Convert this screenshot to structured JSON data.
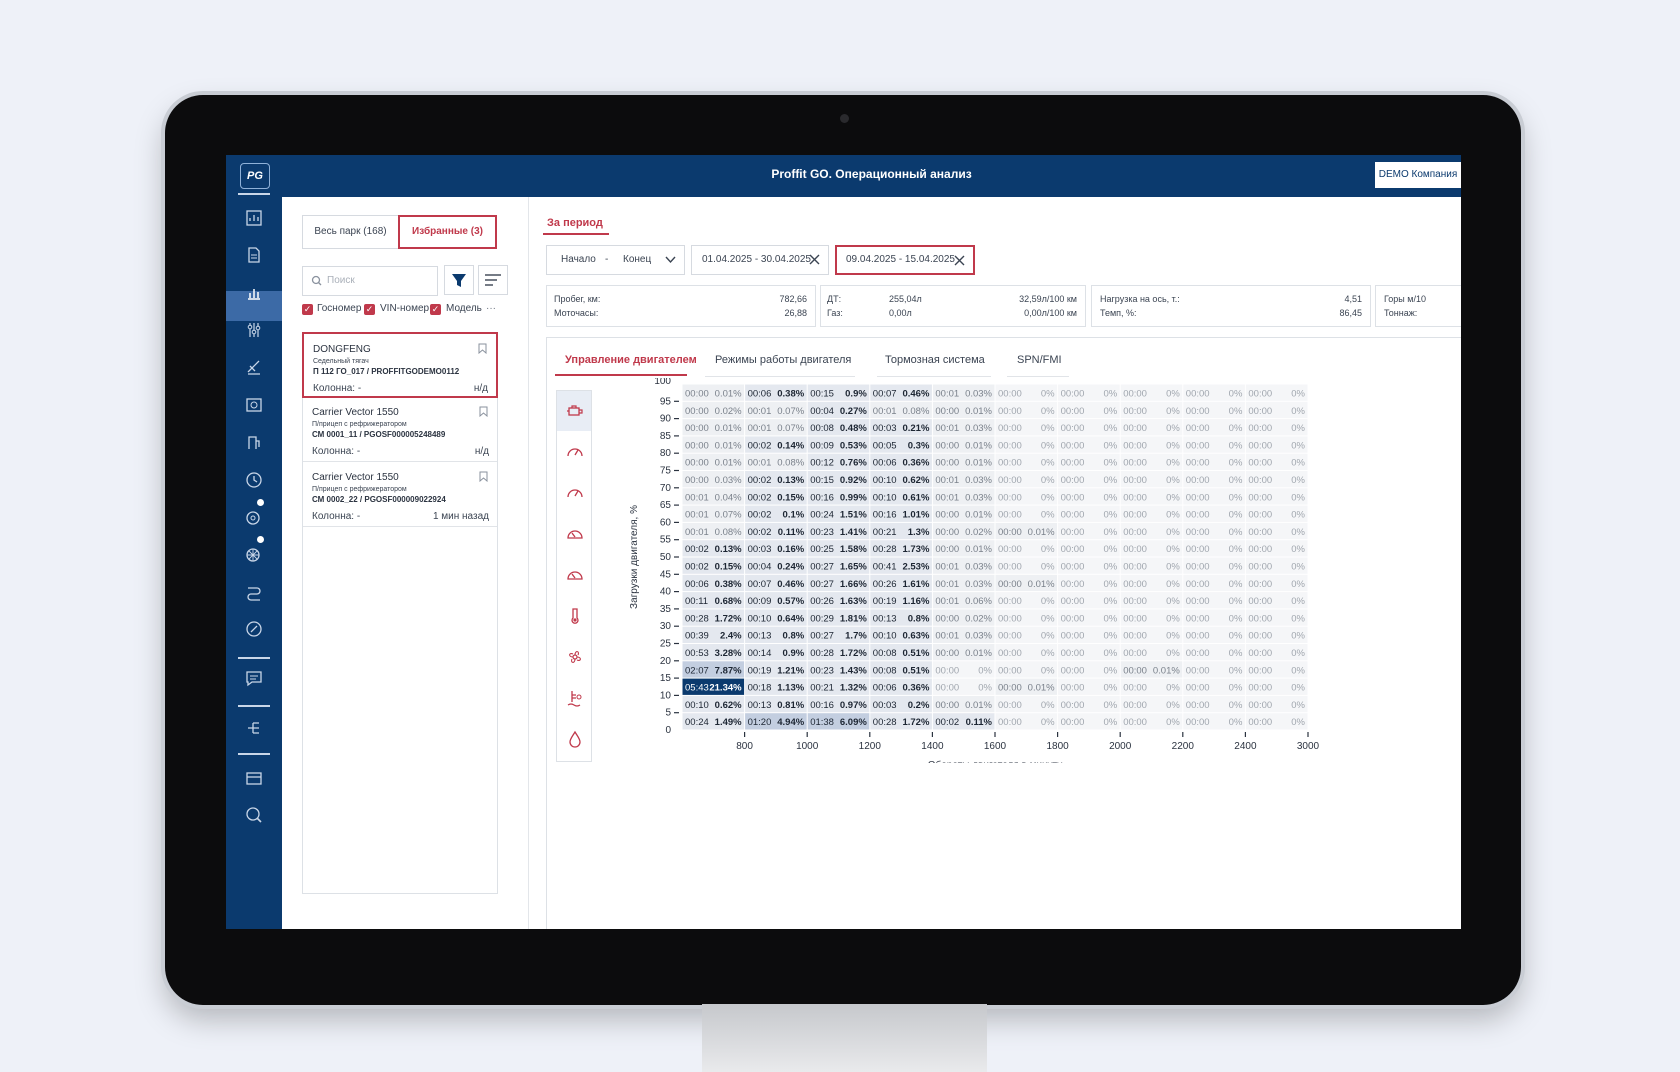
{
  "header": {
    "title": "Proffit GO. Операционный анализ",
    "company": "DEMO Компания"
  },
  "logo": "PG",
  "fleet_tabs": [
    {
      "label": "Весь парк (168)"
    },
    {
      "label": "Избранные (3)"
    }
  ],
  "search": {
    "placeholder": "Поиск"
  },
  "checkboxes": [
    "Госномер",
    "VIN-номер",
    "Модель"
  ],
  "more": "···",
  "vehicles": [
    {
      "name": "DONGFENG",
      "type": "Седельный тягач",
      "number": "П 112 ГО_017 / PROFFITGODEMO0112",
      "column": "Колонна: -",
      "status": "н/д"
    },
    {
      "name": "Carrier Vector 1550",
      "type": "П/прицеп с рефрижератором",
      "number": "СМ 0001_11 / PGOSF000005248489",
      "column": "Колонна: -",
      "status": "н/д"
    },
    {
      "name": "Carrier Vector 1550",
      "type": "П/прицеп с рефрижератором",
      "number": "СМ 0002_22 / PGOSF000009022924",
      "column": "Колонна: -",
      "status": "1 мин назад"
    }
  ],
  "period": {
    "label": "За период",
    "dropdown": {
      "start": "Начало",
      "sep": "-",
      "end": "Конец"
    },
    "ranges": [
      "01.04.2025 - 30.04.2025",
      "09.04.2025 - 15.04.2025"
    ]
  },
  "stats": {
    "mileage_label": "Пробег, км:",
    "mileage": "782,66",
    "motohours_label": "Моточасы:",
    "motohours": "26,88",
    "dt_label": "ДТ:",
    "dt": "255,04л",
    "dt_rate": "32,59л/100 км",
    "gas_label": "Газ:",
    "gas": "0,00л",
    "gas_rate": "0,00л/100 км",
    "axle_label": "Нагрузка на ось, т.:",
    "axle": "4,51",
    "temp_label": "Темп, %:",
    "temp": "86,45",
    "mountains_label": "Горы м/10",
    "tonnage_label": "Тоннаж:"
  },
  "content_tabs": [
    "Управление двигателем",
    "Режимы работы двигателя",
    "Тормозная система",
    "SPN/FMI"
  ],
  "icons": {
    "sidebar": [
      "dashboard-icon",
      "document-icon",
      "analytics-icon",
      "settings-sliders-icon",
      "satellite-icon",
      "reports-icon",
      "fuel-icon",
      "clock-icon",
      "tire-icon",
      "wheel-icon",
      "route-icon",
      "link-icon",
      "chat-icon",
      "hierarchy-icon",
      "card-icon",
      "support-icon"
    ],
    "views": [
      "engine-icon",
      "speedometer-icon",
      "speedometer-icon",
      "gauge-icon",
      "gauge-icon",
      "thermometer-icon",
      "fan-icon",
      "coolant-icon",
      "oil-icon"
    ]
  },
  "colors": {
    "brand": "#0b3a6e",
    "accent": "#c0394b",
    "sidebar_active": "#3c6aa6",
    "heat_hot": "#0b3a6e"
  },
  "chart_data": {
    "type": "heatmap",
    "xlabel": "Обороты двигателя в минуту",
    "ylabel": "Загрузки двигателя, %",
    "x_ticks": [
      "800",
      "1000",
      "1200",
      "1400",
      "1600",
      "1800",
      "2000",
      "2200",
      "2400",
      "3000"
    ],
    "y_ticks": [
      "100",
      "95",
      "90",
      "85",
      "80",
      "75",
      "70",
      "65",
      "60",
      "55",
      "50",
      "45",
      "40",
      "35",
      "30",
      "25",
      "20",
      "15",
      "10",
      "5",
      "0"
    ],
    "rows": [
      [
        [
          "00:00",
          "0.01%"
        ],
        [
          "00:06",
          "0.38%"
        ],
        [
          "00:15",
          "0.9%"
        ],
        [
          "00:07",
          "0.46%"
        ],
        [
          "00:01",
          "0.03%"
        ],
        [
          "00:00",
          "0%"
        ],
        [
          "00:00",
          "0%"
        ],
        [
          "00:00",
          "0%"
        ],
        [
          "00:00",
          "0%"
        ],
        [
          "00:00",
          "0%"
        ]
      ],
      [
        [
          "00:00",
          "0.02%"
        ],
        [
          "00:01",
          "0.07%"
        ],
        [
          "00:04",
          "0.27%"
        ],
        [
          "00:01",
          "0.08%"
        ],
        [
          "00:00",
          "0.01%"
        ],
        [
          "00:00",
          "0%"
        ],
        [
          "00:00",
          "0%"
        ],
        [
          "00:00",
          "0%"
        ],
        [
          "00:00",
          "0%"
        ],
        [
          "00:00",
          "0%"
        ]
      ],
      [
        [
          "00:00",
          "0.01%"
        ],
        [
          "00:01",
          "0.07%"
        ],
        [
          "00:08",
          "0.48%"
        ],
        [
          "00:03",
          "0.21%"
        ],
        [
          "00:01",
          "0.03%"
        ],
        [
          "00:00",
          "0%"
        ],
        [
          "00:00",
          "0%"
        ],
        [
          "00:00",
          "0%"
        ],
        [
          "00:00",
          "0%"
        ],
        [
          "00:00",
          "0%"
        ]
      ],
      [
        [
          "00:00",
          "0.01%"
        ],
        [
          "00:02",
          "0.14%"
        ],
        [
          "00:09",
          "0.53%"
        ],
        [
          "00:05",
          "0.3%"
        ],
        [
          "00:00",
          "0.01%"
        ],
        [
          "00:00",
          "0%"
        ],
        [
          "00:00",
          "0%"
        ],
        [
          "00:00",
          "0%"
        ],
        [
          "00:00",
          "0%"
        ],
        [
          "00:00",
          "0%"
        ]
      ],
      [
        [
          "00:00",
          "0.01%"
        ],
        [
          "00:01",
          "0.08%"
        ],
        [
          "00:12",
          "0.76%"
        ],
        [
          "00:06",
          "0.36%"
        ],
        [
          "00:00",
          "0.01%"
        ],
        [
          "00:00",
          "0%"
        ],
        [
          "00:00",
          "0%"
        ],
        [
          "00:00",
          "0%"
        ],
        [
          "00:00",
          "0%"
        ],
        [
          "00:00",
          "0%"
        ]
      ],
      [
        [
          "00:00",
          "0.03%"
        ],
        [
          "00:02",
          "0.13%"
        ],
        [
          "00:15",
          "0.92%"
        ],
        [
          "00:10",
          "0.62%"
        ],
        [
          "00:01",
          "0.03%"
        ],
        [
          "00:00",
          "0%"
        ],
        [
          "00:00",
          "0%"
        ],
        [
          "00:00",
          "0%"
        ],
        [
          "00:00",
          "0%"
        ],
        [
          "00:00",
          "0%"
        ]
      ],
      [
        [
          "00:01",
          "0.04%"
        ],
        [
          "00:02",
          "0.15%"
        ],
        [
          "00:16",
          "0.99%"
        ],
        [
          "00:10",
          "0.61%"
        ],
        [
          "00:01",
          "0.03%"
        ],
        [
          "00:00",
          "0%"
        ],
        [
          "00:00",
          "0%"
        ],
        [
          "00:00",
          "0%"
        ],
        [
          "00:00",
          "0%"
        ],
        [
          "00:00",
          "0%"
        ]
      ],
      [
        [
          "00:01",
          "0.07%"
        ],
        [
          "00:02",
          "0.1%"
        ],
        [
          "00:24",
          "1.51%"
        ],
        [
          "00:16",
          "1.01%"
        ],
        [
          "00:00",
          "0.01%"
        ],
        [
          "00:00",
          "0%"
        ],
        [
          "00:00",
          "0%"
        ],
        [
          "00:00",
          "0%"
        ],
        [
          "00:00",
          "0%"
        ],
        [
          "00:00",
          "0%"
        ]
      ],
      [
        [
          "00:01",
          "0.08%"
        ],
        [
          "00:02",
          "0.11%"
        ],
        [
          "00:23",
          "1.41%"
        ],
        [
          "00:21",
          "1.3%"
        ],
        [
          "00:00",
          "0.02%"
        ],
        [
          "00:00",
          "0.01%"
        ],
        [
          "00:00",
          "0%"
        ],
        [
          "00:00",
          "0%"
        ],
        [
          "00:00",
          "0%"
        ],
        [
          "00:00",
          "0%"
        ]
      ],
      [
        [
          "00:02",
          "0.13%"
        ],
        [
          "00:03",
          "0.16%"
        ],
        [
          "00:25",
          "1.58%"
        ],
        [
          "00:28",
          "1.73%"
        ],
        [
          "00:00",
          "0.01%"
        ],
        [
          "00:00",
          "0%"
        ],
        [
          "00:00",
          "0%"
        ],
        [
          "00:00",
          "0%"
        ],
        [
          "00:00",
          "0%"
        ],
        [
          "00:00",
          "0%"
        ]
      ],
      [
        [
          "00:02",
          "0.15%"
        ],
        [
          "00:04",
          "0.24%"
        ],
        [
          "00:27",
          "1.65%"
        ],
        [
          "00:41",
          "2.53%"
        ],
        [
          "00:01",
          "0.03%"
        ],
        [
          "00:00",
          "0%"
        ],
        [
          "00:00",
          "0%"
        ],
        [
          "00:00",
          "0%"
        ],
        [
          "00:00",
          "0%"
        ],
        [
          "00:00",
          "0%"
        ]
      ],
      [
        [
          "00:06",
          "0.38%"
        ],
        [
          "00:07",
          "0.46%"
        ],
        [
          "00:27",
          "1.66%"
        ],
        [
          "00:26",
          "1.61%"
        ],
        [
          "00:01",
          "0.03%"
        ],
        [
          "00:00",
          "0.01%"
        ],
        [
          "00:00",
          "0%"
        ],
        [
          "00:00",
          "0%"
        ],
        [
          "00:00",
          "0%"
        ],
        [
          "00:00",
          "0%"
        ]
      ],
      [
        [
          "00:11",
          "0.68%"
        ],
        [
          "00:09",
          "0.57%"
        ],
        [
          "00:26",
          "1.63%"
        ],
        [
          "00:19",
          "1.16%"
        ],
        [
          "00:01",
          "0.06%"
        ],
        [
          "00:00",
          "0%"
        ],
        [
          "00:00",
          "0%"
        ],
        [
          "00:00",
          "0%"
        ],
        [
          "00:00",
          "0%"
        ],
        [
          "00:00",
          "0%"
        ]
      ],
      [
        [
          "00:28",
          "1.72%"
        ],
        [
          "00:10",
          "0.64%"
        ],
        [
          "00:29",
          "1.81%"
        ],
        [
          "00:13",
          "0.8%"
        ],
        [
          "00:00",
          "0.02%"
        ],
        [
          "00:00",
          "0%"
        ],
        [
          "00:00",
          "0%"
        ],
        [
          "00:00",
          "0%"
        ],
        [
          "00:00",
          "0%"
        ],
        [
          "00:00",
          "0%"
        ]
      ],
      [
        [
          "00:39",
          "2.4%"
        ],
        [
          "00:13",
          "0.8%"
        ],
        [
          "00:27",
          "1.7%"
        ],
        [
          "00:10",
          "0.63%"
        ],
        [
          "00:01",
          "0.03%"
        ],
        [
          "00:00",
          "0%"
        ],
        [
          "00:00",
          "0%"
        ],
        [
          "00:00",
          "0%"
        ],
        [
          "00:00",
          "0%"
        ],
        [
          "00:00",
          "0%"
        ]
      ],
      [
        [
          "00:53",
          "3.28%"
        ],
        [
          "00:14",
          "0.9%"
        ],
        [
          "00:28",
          "1.72%"
        ],
        [
          "00:08",
          "0.51%"
        ],
        [
          "00:00",
          "0.01%"
        ],
        [
          "00:00",
          "0%"
        ],
        [
          "00:00",
          "0%"
        ],
        [
          "00:00",
          "0%"
        ],
        [
          "00:00",
          "0%"
        ],
        [
          "00:00",
          "0%"
        ]
      ],
      [
        [
          "02:07",
          "7.87%"
        ],
        [
          "00:19",
          "1.21%"
        ],
        [
          "00:23",
          "1.43%"
        ],
        [
          "00:08",
          "0.51%"
        ],
        [
          "00:00",
          "0%"
        ],
        [
          "00:00",
          "0%"
        ],
        [
          "00:00",
          "0%"
        ],
        [
          "00:00",
          "0.01%"
        ],
        [
          "00:00",
          "0%"
        ],
        [
          "00:00",
          "0%"
        ]
      ],
      [
        [
          "05:43",
          "21.34%"
        ],
        [
          "00:18",
          "1.13%"
        ],
        [
          "00:21",
          "1.32%"
        ],
        [
          "00:06",
          "0.36%"
        ],
        [
          "00:00",
          "0%"
        ],
        [
          "00:00",
          "0.01%"
        ],
        [
          "00:00",
          "0%"
        ],
        [
          "00:00",
          "0%"
        ],
        [
          "00:00",
          "0%"
        ],
        [
          "00:00",
          "0%"
        ]
      ],
      [
        [
          "00:10",
          "0.62%"
        ],
        [
          "00:13",
          "0.81%"
        ],
        [
          "00:16",
          "0.97%"
        ],
        [
          "00:03",
          "0.2%"
        ],
        [
          "00:00",
          "0.01%"
        ],
        [
          "00:00",
          "0%"
        ],
        [
          "00:00",
          "0%"
        ],
        [
          "00:00",
          "0%"
        ],
        [
          "00:00",
          "0%"
        ],
        [
          "00:00",
          "0%"
        ]
      ],
      [
        [
          "00:24",
          "1.49%"
        ],
        [
          "01:20",
          "4.94%"
        ],
        [
          "01:38",
          "6.09%"
        ],
        [
          "00:28",
          "1.72%"
        ],
        [
          "00:02",
          "0.11%"
        ],
        [
          "00:00",
          "0%"
        ],
        [
          "00:00",
          "0%"
        ],
        [
          "00:00",
          "0%"
        ],
        [
          "00:00",
          "0%"
        ],
        [
          "00:00",
          "0%"
        ]
      ]
    ]
  }
}
